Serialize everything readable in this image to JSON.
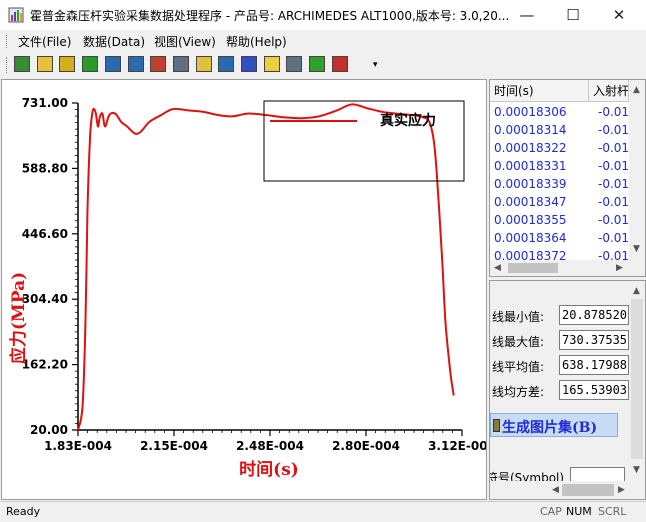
{
  "window": {
    "title": "霍普金森压杆实验采集数据处理程序 - 产品号: ARCHIMEDES ALT1000,版本号: 3.0,20...",
    "minimize": "—",
    "maximize": "☐",
    "close": "✕"
  },
  "menu": {
    "file": "文件(File)",
    "data": "数据(Data)",
    "view": "视图(View)",
    "help": "帮助(Help)"
  },
  "toolbar": {
    "buttons": [
      {
        "icon": "open-icon",
        "color": "#3a8a3a"
      },
      {
        "icon": "folder-icon",
        "color": "#e8c040"
      },
      {
        "icon": "save-icon",
        "color": "#d4b020"
      },
      {
        "icon": "document-icon",
        "color": "#2a9a2a"
      },
      {
        "icon": "chart-tool-icon",
        "color": "#2a6ab0"
      },
      {
        "icon": "bar-chart-icon",
        "color": "#2a6ab0"
      },
      {
        "icon": "table-edit-icon",
        "color": "#c04030"
      },
      {
        "icon": "grid-icon",
        "color": "#607080"
      },
      {
        "icon": "flag-icon",
        "color": "#e0c040"
      },
      {
        "icon": "refresh-icon",
        "color": "#2a6ab0"
      },
      {
        "icon": "calculator-icon",
        "color": "#3050c0"
      },
      {
        "icon": "help-icon",
        "color": "#e8d040"
      },
      {
        "icon": "notepad-icon",
        "color": "#607080"
      },
      {
        "icon": "curve-edit-icon",
        "color": "#30a030"
      },
      {
        "icon": "export-icon",
        "color": "#c03030"
      }
    ],
    "more": "▾"
  },
  "chart_data": {
    "type": "line",
    "xlabel": "时间(s)",
    "ylabel": "应力(MPa)",
    "xlim": [
      0.000183,
      0.000312
    ],
    "ylim": [
      20.0,
      731.0
    ],
    "x_ticks": [
      "1.83E-004",
      "2.15E-004",
      "2.48E-004",
      "2.80E-004",
      "3.12E-004"
    ],
    "y_ticks": [
      "731.00",
      "588.80",
      "446.60",
      "304.40",
      "162.20",
      "20.00"
    ],
    "legend": {
      "position": "top-right",
      "label": "真实应力"
    },
    "series": [
      {
        "name": "真实应力",
        "color": "#e01010",
        "x": [
          0.000183,
          0.0001845,
          0.0001855,
          0.0001862,
          0.000187,
          0.0001876,
          0.0001882,
          0.000189,
          0.0001897,
          0.0001903,
          0.0001912,
          0.0001921,
          0.0001935,
          0.0001955,
          0.0001975,
          0.0001995,
          0.000202,
          0.000204,
          0.000207,
          0.000211,
          0.000215,
          0.00022,
          0.000225,
          0.00023,
          0.000235,
          0.00024,
          0.000246,
          0.000252,
          0.000258,
          0.000264,
          0.00027,
          0.000275,
          0.00028,
          0.000285,
          0.00029,
          0.000295,
          0.000299,
          0.000301,
          0.0003025,
          0.0003035,
          0.0003045,
          0.0003055,
          0.0003065,
          0.000308,
          0.0003092
        ],
        "y": [
          20,
          70,
          250,
          500,
          650,
          700,
          718,
          708,
          680,
          700,
          708,
          680,
          705,
          708,
          690,
          680,
          665,
          668,
          690,
          705,
          718,
          715,
          712,
          705,
          702,
          708,
          705,
          700,
          698,
          702,
          715,
          728,
          720,
          712,
          708,
          705,
          700,
          690,
          650,
          580,
          480,
          370,
          250,
          150,
          95
        ]
      }
    ]
  },
  "table": {
    "headers": [
      "时间(s)",
      "入射杆"
    ],
    "rows": [
      {
        "time": "0.00018306",
        "value": "-0.01"
      },
      {
        "time": "0.00018314",
        "value": "-0.01"
      },
      {
        "time": "0.00018322",
        "value": "-0.01"
      },
      {
        "time": "0.00018331",
        "value": "-0.01"
      },
      {
        "time": "0.00018339",
        "value": "-0.01"
      },
      {
        "time": "0.00018347",
        "value": "-0.01"
      },
      {
        "time": "0.00018355",
        "value": "-0.01"
      },
      {
        "time": "0.00018364",
        "value": "-0.01"
      },
      {
        "time": "0.00018372",
        "value": "-0.01"
      }
    ]
  },
  "stats": {
    "min_label": "线最小值:",
    "min_value": "20.878520",
    "max_label": "线最大值:",
    "max_value": "730.37535",
    "mean_label": "线平均值:",
    "mean_value": "638.17988",
    "var_label": "线均方差:",
    "var_value": "165.53903",
    "generate_button": "生成图片集(B)",
    "symbol_label": "符号(Symbol)"
  },
  "status": {
    "text": "Ready",
    "cap": "CAP",
    "num": "NUM",
    "scrl": "SCRL"
  }
}
